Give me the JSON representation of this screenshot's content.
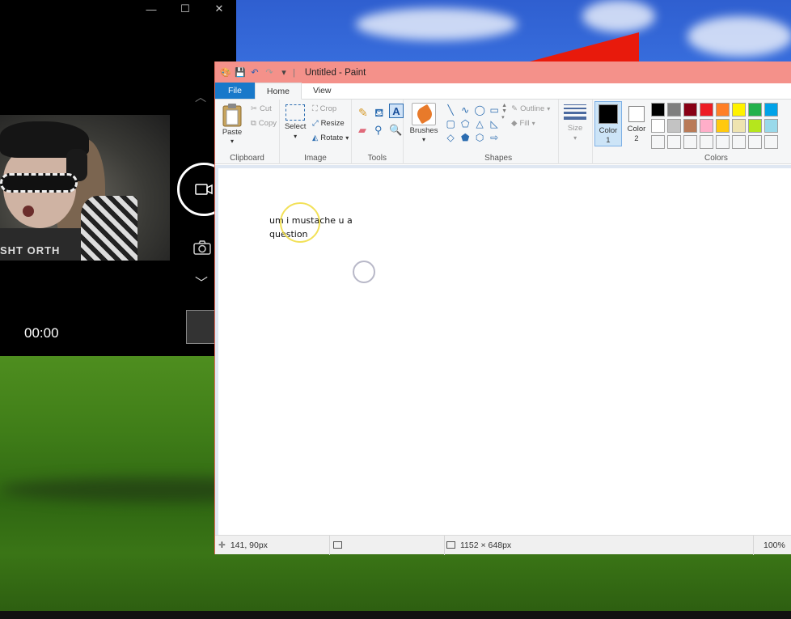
{
  "camera": {
    "timer": "00:00",
    "preview_shirt_text": "SHT ORTH"
  },
  "paint": {
    "window_title": "Untitled - Paint",
    "tabs": [
      "File",
      "Home",
      "View"
    ],
    "clipboard": {
      "paste": "Paste",
      "cut": "Cut",
      "copy": "Copy",
      "label": "Clipboard"
    },
    "image": {
      "select": "Select",
      "crop": "Crop",
      "resize": "Resize",
      "rotate": "Rotate",
      "label": "Image"
    },
    "tools": {
      "label": "Tools",
      "brushes": "Brushes"
    },
    "shapes": {
      "outline": "Outline",
      "fill": "Fill",
      "label": "Shapes"
    },
    "size": {
      "label": "Size"
    },
    "colors": {
      "color1": "Color 1",
      "color2": "Color 2",
      "label": "Colors",
      "palette": [
        "#000000",
        "#7f7f7f",
        "#880015",
        "#ed1c24",
        "#ff7f27",
        "#fff200",
        "#22b14c",
        "#00a2e8",
        "#ffffff",
        "#c3c3c3",
        "#b97a57",
        "#ffaec9",
        "#ffc90e",
        "#efe4b0",
        "#b5e61d",
        "#99d9ea",
        "#f5f6f7",
        "#f5f6f7",
        "#f5f6f7",
        "#f5f6f7",
        "#f5f6f7",
        "#f5f6f7",
        "#f5f6f7",
        "#f5f6f7"
      ]
    },
    "canvas_text_line1": "um i mustache u a",
    "canvas_text_line2": "question",
    "status": {
      "cursor_pos": "141, 90px",
      "canvas_size": "1152 × 648px",
      "zoom": "100%"
    }
  }
}
